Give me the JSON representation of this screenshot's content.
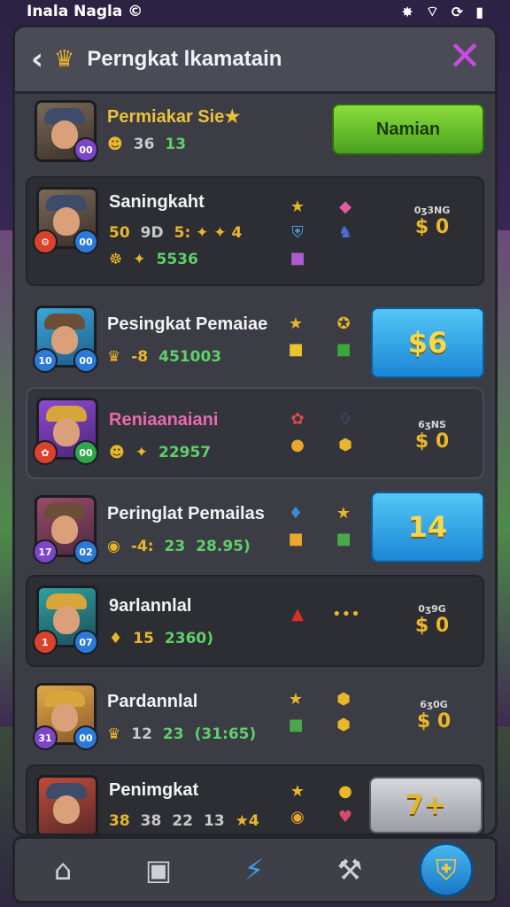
{
  "status": {
    "carrier": "Inala Nagla ©",
    "wifi_icon": "wifi-icon",
    "battery_icon": "battery-icon"
  },
  "header": {
    "title": "Perngkat lkamatain",
    "back_icon": "back-arrow-icon",
    "badge_icon": "trophy-icon",
    "close_icon": "close-icon"
  },
  "rows": [
    {
      "name": "Permiakar Sie★",
      "name_color": "gold",
      "stats": [
        "☻",
        "36",
        "13"
      ],
      "button": "Namian",
      "button_type": "green",
      "badges": [
        "00"
      ]
    },
    {
      "name": "Saningkaht",
      "stats_line1": [
        "50",
        "9D",
        "5: ✦ ✦ 4"
      ],
      "stats_line2": [
        "☸",
        "✦",
        "5536"
      ],
      "reward_label": "0ʒ3NG",
      "reward_value": "$ 0",
      "badges": [
        "⚙",
        "00"
      ]
    },
    {
      "name": "Pesingkat Pemaiae",
      "stats": [
        "♛",
        "-8",
        "451003"
      ],
      "button": "$6",
      "button_type": "blue",
      "badges": [
        "10",
        "00"
      ]
    },
    {
      "name": "Reniaanaiani",
      "name_color": "pink",
      "stats": [
        "☻",
        "✦",
        "22957"
      ],
      "reward_label": "6ʒNS",
      "reward_value": "$ 0",
      "badges": [
        "✿",
        "00"
      ]
    },
    {
      "name": "Peringlat Pemailas",
      "stats": [
        "◉",
        "-4:",
        "23",
        "28.95)"
      ],
      "button": "14",
      "button_type": "blue",
      "badges": [
        "17",
        "02"
      ]
    },
    {
      "name": "9arlannlal",
      "stats": [
        "♦",
        "15",
        "2360)"
      ],
      "reward_label": "0ʒ9G",
      "reward_value": "$ 0",
      "badges": [
        "1",
        "07"
      ]
    },
    {
      "name": "Pardannlal",
      "stats": [
        "♛",
        "12",
        "23",
        "(31:65)"
      ],
      "reward_label": "6ʒ0G",
      "reward_value": "$ 0",
      "badges": [
        "31",
        "00"
      ]
    },
    {
      "name": "Penimgkat",
      "stats": [
        "38",
        "38",
        "22",
        "13",
        "★4"
      ],
      "button": "7+",
      "button_type": "gray"
    }
  ],
  "nav": [
    {
      "name": "home-icon",
      "label": "⌂"
    },
    {
      "name": "inventory-icon",
      "label": "▣"
    },
    {
      "name": "bolt-icon",
      "label": "⚡"
    },
    {
      "name": "hammer-icon",
      "label": "⚒"
    },
    {
      "name": "shield-icon",
      "label": "⛨"
    }
  ],
  "colors": {
    "accent_green": "#6cc52a",
    "accent_blue": "#2b9fe6",
    "gold": "#e9b72a",
    "close": "#c64be0"
  }
}
